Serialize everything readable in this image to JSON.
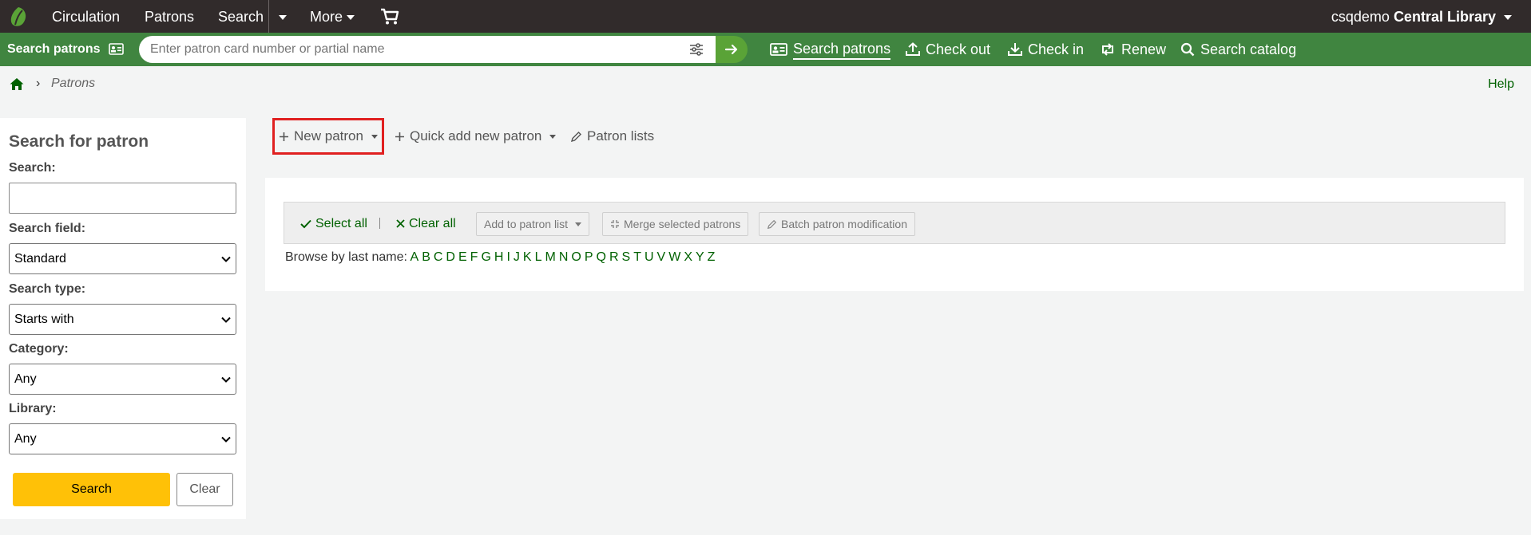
{
  "topnav": {
    "items": [
      "Circulation",
      "Patrons",
      "Search",
      "More"
    ],
    "user": "csqdemo",
    "library": "Central Library"
  },
  "searchbar": {
    "label": "Search patrons",
    "placeholder": "Enter patron card number or partial name",
    "links": [
      "Search patrons",
      "Check out",
      "Check in",
      "Renew",
      "Search catalog"
    ]
  },
  "breadcrumb": {
    "current": "Patrons",
    "separator": "›"
  },
  "help": "Help",
  "search_panel": {
    "title": "Search for patron",
    "search_label": "Search:",
    "field_label": "Search field:",
    "field_value": "Standard",
    "type_label": "Search type:",
    "type_value": "Starts with",
    "category_label": "Category:",
    "category_value": "Any",
    "library_label": "Library:",
    "library_value": "Any",
    "search_button": "Search",
    "clear_button": "Clear"
  },
  "toolbar": {
    "new_patron": "New patron",
    "quick_add": "Quick add new patron",
    "patron_lists": "Patron lists"
  },
  "actions": {
    "select_all": "Select all",
    "clear_all": "Clear all",
    "add_to_list": "Add to patron list",
    "merge": "Merge selected patrons",
    "batch": "Batch patron modification"
  },
  "browse": {
    "label": "Browse by last name:",
    "letters": [
      "A",
      "B",
      "C",
      "D",
      "E",
      "F",
      "G",
      "H",
      "I",
      "J",
      "K",
      "L",
      "M",
      "N",
      "O",
      "P",
      "Q",
      "R",
      "S",
      "T",
      "U",
      "V",
      "W",
      "X",
      "Y",
      "Z"
    ]
  },
  "colors": {
    "topnav": "#312b2b",
    "greenbar": "#408540",
    "link": "#006100",
    "search_button": "#ffc107",
    "highlight": "#e02020"
  }
}
